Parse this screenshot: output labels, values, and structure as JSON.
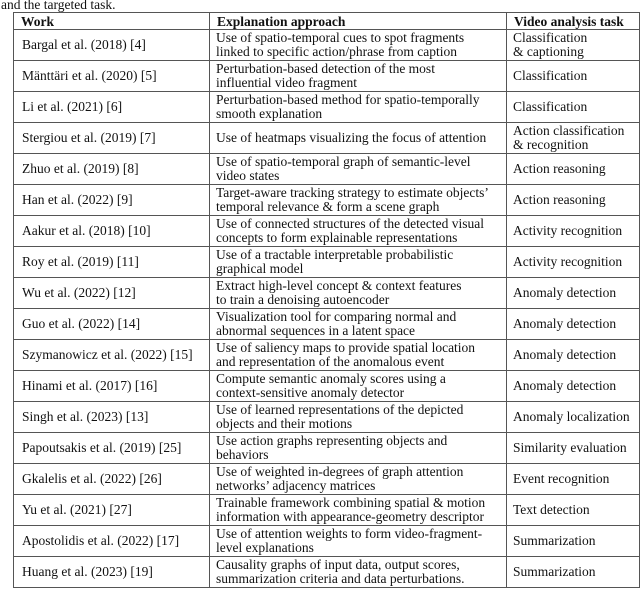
{
  "caption": "and the targeted task.",
  "table": {
    "headers": [
      "Work",
      "Explanation approach",
      "Video analysis task"
    ],
    "rows": [
      {
        "work": "Bargal et al. (2018) [4]",
        "explanation": [
          "Use of spatio-temporal cues to spot fragments",
          "linked to specific action/phrase from caption"
        ],
        "task": [
          "Classification",
          "& captioning"
        ]
      },
      {
        "work": "Mänttäri et al. (2020) [5]",
        "explanation": [
          "Perturbation-based detection of the most",
          "influential video fragment"
        ],
        "task": [
          "Classification"
        ]
      },
      {
        "work": "Li et al. (2021) [6]",
        "explanation": [
          "Perturbation-based method for spatio-temporally",
          "smooth explanation"
        ],
        "task": [
          "Classification"
        ]
      },
      {
        "work": "Stergiou et al. (2019) [7]",
        "explanation": [
          "Use of heatmaps visualizing the focus of attention"
        ],
        "task": [
          "Action classification",
          "& recognition"
        ]
      },
      {
        "work": "Zhuo et al. (2019) [8]",
        "explanation": [
          "Use of spatio-temporal graph of semantic-level",
          "video states"
        ],
        "task": [
          "Action reasoning"
        ]
      },
      {
        "work": "Han et al. (2022) [9]",
        "explanation": [
          "Target-aware tracking strategy to estimate objects’",
          "temporal relevance & form a scene graph"
        ],
        "task": [
          "Action reasoning"
        ]
      },
      {
        "work": "Aakur et al. (2018) [10]",
        "explanation": [
          "Use of connected structures of the detected visual",
          "concepts to form explainable representations"
        ],
        "task": [
          "Activity recognition"
        ]
      },
      {
        "work": "Roy et al. (2019) [11]",
        "explanation": [
          "Use of a tractable interpretable probabilistic",
          "graphical model"
        ],
        "task": [
          "Activity recognition"
        ]
      },
      {
        "work": "Wu et al. (2022) [12]",
        "explanation": [
          "Extract high-level concept & context features",
          "to train a denoising autoencoder"
        ],
        "task": [
          "Anomaly detection"
        ]
      },
      {
        "work": "Guo et al. (2022) [14]",
        "explanation": [
          "Visualization tool for comparing normal and",
          "abnormal sequences in a latent space"
        ],
        "task": [
          "Anomaly detection"
        ]
      },
      {
        "work": "Szymanowicz et al. (2022) [15]",
        "explanation": [
          "Use of saliency maps to provide spatial location",
          "and representation of the anomalous event"
        ],
        "task": [
          "Anomaly detection"
        ]
      },
      {
        "work": "Hinami et al. (2017) [16]",
        "explanation": [
          "Compute semantic anomaly scores using a",
          "context-sensitive anomaly detector"
        ],
        "task": [
          "Anomaly detection"
        ]
      },
      {
        "work": "Singh et al. (2023) [13]",
        "explanation": [
          "Use of learned representations of the depicted",
          "objects and their motions"
        ],
        "task": [
          "Anomaly localization"
        ]
      },
      {
        "work": "Papoutsakis et al. (2019) [25]",
        "explanation": [
          "Use action graphs representing objects and",
          "behaviors"
        ],
        "task": [
          "Similarity evaluation"
        ]
      },
      {
        "work": "Gkalelis et al. (2022) [26]",
        "explanation": [
          "Use of weighted in-degrees of graph attention",
          "networks’ adjacency matrices"
        ],
        "task": [
          "Event recognition"
        ]
      },
      {
        "work": "Yu et al. (2021) [27]",
        "explanation": [
          "Trainable framework combining spatial & motion",
          "information with appearance-geometry descriptor"
        ],
        "task": [
          "Text detection"
        ]
      },
      {
        "work": "Apostolidis et al. (2022) [17]",
        "explanation": [
          "Use of attention weights to form video-fragment-",
          "level explanations"
        ],
        "task": [
          "Summarization"
        ]
      },
      {
        "work": "Huang et al. (2023) [19]",
        "explanation": [
          "Causality graphs of input data, output scores,",
          "summarization criteria and data perturbations."
        ],
        "task": [
          "Summarization"
        ]
      }
    ]
  }
}
